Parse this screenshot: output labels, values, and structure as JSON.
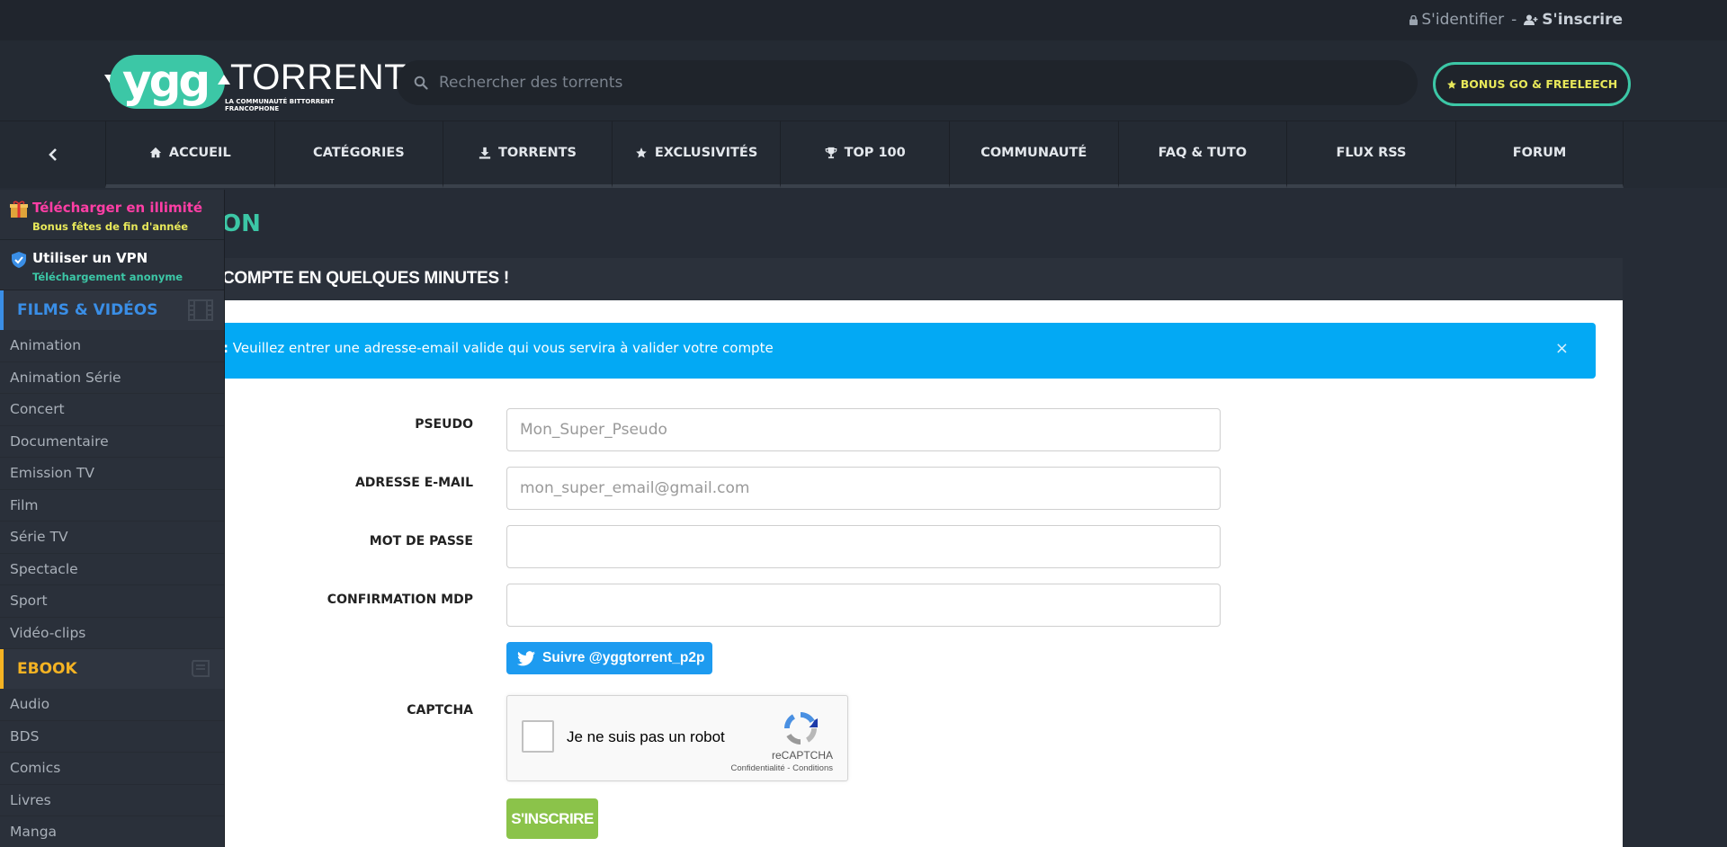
{
  "topbar": {
    "login_label": "S'identifier",
    "separator": "-",
    "signup_label": "S'inscrire"
  },
  "header": {
    "logo_ygg": "ygg",
    "logo_torrent": "TORRENT",
    "logo_tagline": "LA COMMUNAUTÉ BITTORRENT FRANCOPHONE",
    "search_placeholder": "Rechercher des torrents",
    "bonus_label": "BONUS GO & FREELEECH"
  },
  "nav": {
    "tabs": [
      {
        "label": "ACCUEIL",
        "icon": "home-icon"
      },
      {
        "label": "CATÉGORIES",
        "icon": ""
      },
      {
        "label": "TORRENTS",
        "icon": "download-icon"
      },
      {
        "label": "EXCLUSIVITÉS",
        "icon": "star-icon"
      },
      {
        "label": "TOP 100",
        "icon": "trophy-icon"
      },
      {
        "label": "COMMUNAUTÉ",
        "icon": ""
      },
      {
        "label": "FAQ & TUTO",
        "icon": ""
      },
      {
        "label": "FLUX RSS",
        "icon": ""
      },
      {
        "label": "FORUM",
        "icon": ""
      }
    ]
  },
  "main": {
    "title_visible": "ON",
    "panel_heading": "COMPTE EN QUELQUES MINUTES !",
    "alert": {
      "prefix": ":",
      "text": " Veuillez entrer une adresse-email valide qui vous servira à valider votre compte",
      "close": "×"
    },
    "form": {
      "pseudo_label": "PSEUDO",
      "pseudo_placeholder": "Mon_Super_Pseudo",
      "email_label": "ADRESSE E-MAIL",
      "email_placeholder": "mon_super_email@gmail.com",
      "password_label": "MOT DE PASSE",
      "confirm_label": "CONFIRMATION MDP",
      "twitter_label": "Suivre @yggtorrent_p2p",
      "captcha_label": "CAPTCHA",
      "captcha_text": "Je ne suis pas un robot",
      "captcha_brand": "reCAPTCHA",
      "captcha_terms": "Confidentialité - Conditions",
      "submit_label": "S'INSCRIRE"
    }
  },
  "sidebar": {
    "promos": [
      {
        "title": "Télécharger en illimité",
        "subtitle": "Bonus fêtes de fin d'année",
        "title_color": "#ff3ea5",
        "subtitle_color": "#e8e85a",
        "icon": "gift-icon"
      },
      {
        "title": "Utiliser un VPN",
        "subtitle": "Téléchargement anonyme",
        "title_color": "#ffffff",
        "subtitle_color": "#3cc7a6",
        "icon": "shield-check-icon"
      }
    ],
    "categories": [
      {
        "name": "FILMS & VIDÉOS",
        "color": "#3a8ee6",
        "icon": "film-icon",
        "items": [
          "Animation",
          "Animation Série",
          "Concert",
          "Documentaire",
          "Emission TV",
          "Film",
          "Série TV",
          "Spectacle",
          "Sport",
          "Vidéo-clips"
        ]
      },
      {
        "name": "EBOOK",
        "color": "#f5b323",
        "icon": "book-icon",
        "items": [
          "Audio",
          "BDS",
          "Comics",
          "Livres",
          "Manga"
        ]
      }
    ]
  },
  "colors": {
    "accent": "#3cc7a6",
    "alert_bg": "#03a9f4",
    "submit_bg": "#8bc34a",
    "twitter_bg": "#1d9bf0"
  }
}
